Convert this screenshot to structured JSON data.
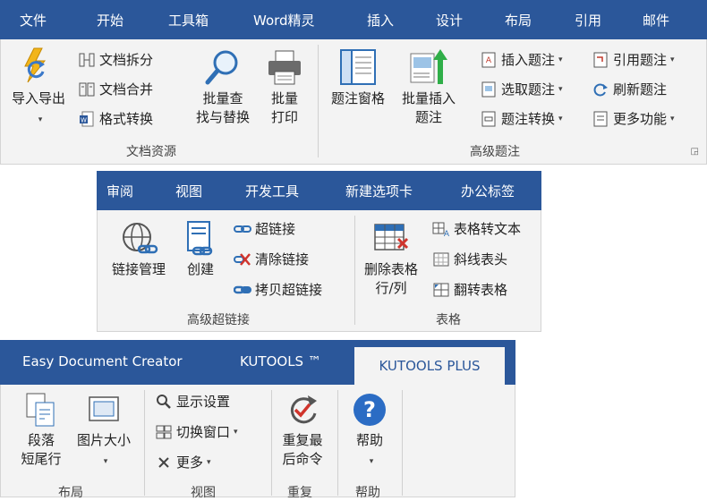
{
  "ribbon1": {
    "tabs": [
      "文件",
      "开始",
      "工具箱",
      "Word精灵",
      "插入",
      "设计",
      "布局",
      "引用",
      "邮件"
    ],
    "import_export": "导入导出",
    "doc_split": "文档拆分",
    "doc_merge": "文档合并",
    "format_convert": "格式转换",
    "batch_find_1": "批量查",
    "batch_find_2": "找与替换",
    "batch_print_1": "批量",
    "batch_print_2": "打印",
    "group_doc_resources": "文档资源",
    "caption_pane": "题注窗格",
    "batch_insert_1": "批量插入",
    "batch_insert_2": "题注",
    "insert_caption": "插入题注",
    "select_caption": "选取题注",
    "caption_convert": "题注转换",
    "ref_caption": "引用题注",
    "refresh_caption": "刷新题注",
    "more_functions": "更多功能",
    "group_advanced_caption": "高级题注"
  },
  "ribbon2": {
    "tabs": [
      "审阅",
      "视图",
      "开发工具",
      "新建选项卡",
      "办公标签"
    ],
    "link_manage": "链接管理",
    "create": "创建",
    "hyperlink": "超链接",
    "clear_links": "清除链接",
    "copy_hyperlink": "拷贝超链接",
    "group_advanced_hyperlink": "高级超链接",
    "delete_table_1": "删除表格",
    "delete_table_2": "行/列",
    "table_to_text": "表格转文本",
    "diagonal_header": "斜线表头",
    "flip_table": "翻转表格",
    "group_table": "表格"
  },
  "ribbon3": {
    "tabs": [
      "Easy Document Creator",
      "KUTOOLS ™",
      "KUTOOLS PLUS"
    ],
    "para_1": "段落",
    "para_2": "短尾行",
    "pic_size": "图片大小",
    "group_layout": "布局",
    "display_settings": "显示设置",
    "switch_window": "切换窗口",
    "more": "更多",
    "group_view": "视图",
    "repeat_1": "重复最",
    "repeat_2": "后命令",
    "group_repeat": "重复",
    "help": "帮助",
    "group_help": "帮助"
  }
}
